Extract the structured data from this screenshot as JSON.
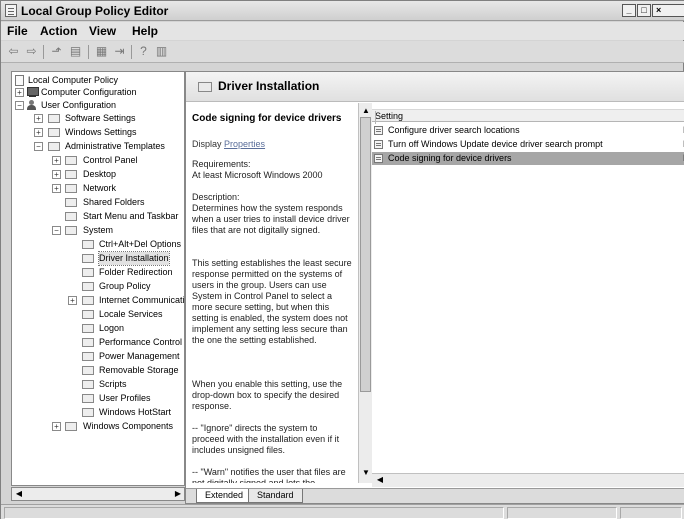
{
  "window": {
    "title": "Local Group Policy Editor"
  },
  "menu": [
    "File",
    "Action",
    "View",
    "Help"
  ],
  "toolbar": {
    "icons": [
      "back-arrow-icon",
      "forward-arrow-icon",
      "up-folder-icon",
      "show-hide-tree-icon",
      "properties-icon",
      "export-list-icon",
      "help-icon",
      "show-hide-action-pane-icon"
    ]
  },
  "tree": {
    "items": [
      {
        "label": "Local Computer Policy",
        "expander": ""
      },
      {
        "label": "Computer Configuration",
        "expander": "+"
      },
      {
        "label": "User Configuration",
        "expander": "−"
      },
      {
        "label": "Software Settings",
        "expander": "+"
      },
      {
        "label": "Windows Settings",
        "expander": "+"
      },
      {
        "label": "Administrative Templates",
        "expander": "−"
      },
      {
        "label": "Control Panel",
        "expander": "+"
      },
      {
        "label": "Desktop",
        "expander": "+"
      },
      {
        "label": "Network",
        "expander": "+"
      },
      {
        "label": "Shared Folders",
        "expander": ""
      },
      {
        "label": "Start Menu and Taskbar",
        "expander": ""
      },
      {
        "label": "System",
        "expander": "−"
      },
      {
        "label": "Ctrl+Alt+Del Options",
        "expander": ""
      },
      {
        "label": "Driver Installation",
        "expander": ""
      },
      {
        "label": "Folder Redirection",
        "expander": ""
      },
      {
        "label": "Group Policy",
        "expander": ""
      },
      {
        "label": "Internet Communication",
        "expander": "+"
      },
      {
        "label": "Locale Services",
        "expander": ""
      },
      {
        "label": "Logon",
        "expander": ""
      },
      {
        "label": "Performance Control",
        "expander": ""
      },
      {
        "label": "Power Management",
        "expander": ""
      },
      {
        "label": "Removable Storage",
        "expander": ""
      },
      {
        "label": "Scripts",
        "expander": ""
      },
      {
        "label": "User Profiles",
        "expander": ""
      },
      {
        "label": "Windows HotStart",
        "expander": ""
      },
      {
        "label": "Windows Components",
        "expander": "+"
      }
    ],
    "scroll_left": "◀",
    "scroll_right": "▶"
  },
  "details": {
    "folder_title": "Driver Installation",
    "setting_title": "Code signing for device drivers",
    "display_prefix": "Display",
    "display_link": "Properties",
    "requirements_label": "Requirements:",
    "requirements_value": "At least Microsoft Windows 2000",
    "description_label": "Description:",
    "description_p1": "Determines how the system responds when a user tries to install device driver files that are not digitally signed.",
    "description_p2": "This setting establishes the least secure response permitted on the systems of users in the group. Users can use System in Control Panel to select a more secure setting, but when this setting is enabled, the system does not implement any setting less secure than the one the setting established.",
    "description_p3": "When you enable this setting, use the drop-down box to specify the desired response.",
    "description_p4": "-- \"Ignore\" directs the system to proceed with the installation even if it includes unsigned files.",
    "description_p5": "-- \"Warn\" notifies the user that files are not digitally signed and lets the",
    "scroll_up": "▲",
    "scroll_down": "▼"
  },
  "list": {
    "column_header": "Setting",
    "rows": [
      {
        "label": "Configure driver search locations",
        "state": "N"
      },
      {
        "label": "Turn off Windows Update device driver search prompt",
        "state": "N"
      },
      {
        "label": "Code signing for device drivers",
        "state": "N"
      }
    ],
    "scroll_left": "◀"
  },
  "tabs": [
    "Extended",
    "Standard"
  ]
}
